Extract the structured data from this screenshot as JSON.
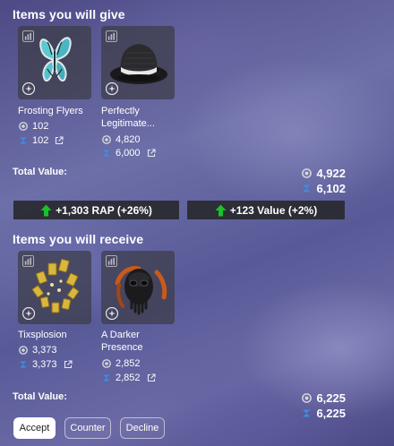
{
  "give": {
    "title": "Items you will give",
    "items": [
      {
        "name": "Frosting Flyers",
        "rap": "102",
        "value": "102"
      },
      {
        "name": "Perfectly Legitimate...",
        "rap": "4,820",
        "value": "6,000"
      }
    ],
    "total_label": "Total Value:",
    "total_rap": "4,922",
    "total_value": "6,102"
  },
  "gains": {
    "rap_gain": "+1,303 RAP (+26%)",
    "value_gain": "+123 Value (+2%)",
    "arrow_color": "#19c12a"
  },
  "receive": {
    "title": "Items you will receive",
    "items": [
      {
        "name": "Tixsplosion",
        "rap": "3,373",
        "value": "3,373"
      },
      {
        "name": "A Darker Presence",
        "rap": "2,852",
        "value": "2,852"
      }
    ],
    "total_label": "Total Value:",
    "total_rap": "6,225",
    "total_value": "6,225"
  },
  "actions": {
    "accept": "Accept",
    "counter": "Counter",
    "decline": "Decline"
  },
  "icons": {
    "item_stats": "chart-icon",
    "item_details": "sparkle-icon",
    "rap": "rap-icon",
    "value": "rolimons-value-icon",
    "external": "external-link-icon",
    "gain": "up-arrow-icon"
  },
  "colors": {
    "value_icon": "#3b8ee8",
    "card_bg": "#3c3c46",
    "gain_bg": "#28282c"
  }
}
